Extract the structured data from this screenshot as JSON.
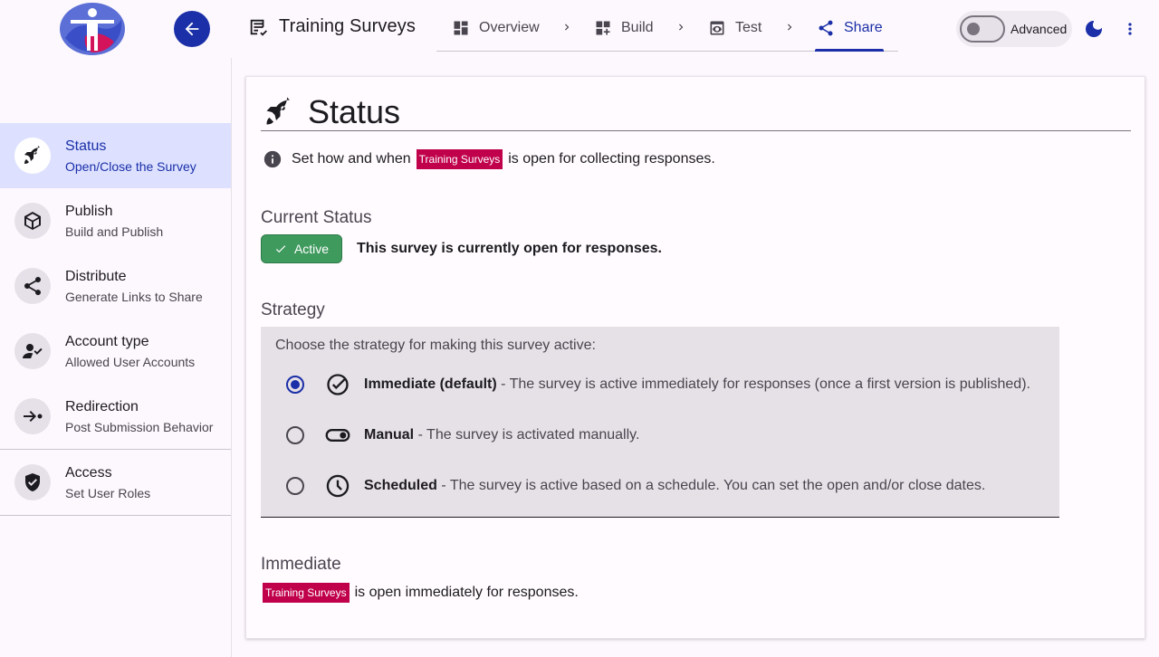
{
  "app": {
    "title": "Training Surveys"
  },
  "steps": [
    {
      "label": "Overview",
      "icon": "dashboard-icon"
    },
    {
      "label": "Build",
      "icon": "dashboard-add-icon"
    },
    {
      "label": "Test",
      "icon": "preview-icon"
    },
    {
      "label": "Share",
      "icon": "share-icon",
      "active": true
    }
  ],
  "toolbar": {
    "advanced_label": "Advanced",
    "advanced_on": false
  },
  "sidebar": {
    "items": [
      {
        "title": "Status",
        "subtitle": "Open/Close the Survey",
        "icon": "rocket-icon",
        "selected": true
      },
      {
        "title": "Publish",
        "subtitle": "Build and Publish",
        "icon": "package-icon"
      },
      {
        "title": "Distribute",
        "subtitle": "Generate Links to Share",
        "icon": "share-icon"
      },
      {
        "title": "Account type",
        "subtitle": "Allowed User Accounts",
        "icon": "person-check-icon"
      },
      {
        "title": "Redirection",
        "subtitle": "Post Submission Behavior",
        "icon": "redirect-icon"
      },
      {
        "title": "Access",
        "subtitle": "Set User Roles",
        "icon": "shield-check-icon"
      }
    ]
  },
  "main": {
    "heading": "Status",
    "info_prefix": "Set how and when",
    "survey_name": "Training Surveys",
    "info_suffix": "is open for collecting responses.",
    "current_status_title": "Current Status",
    "status_chip": "Active",
    "status_message": "This survey is currently open for responses.",
    "strategy_title": "Strategy",
    "strategy_prompt": "Choose the strategy for making this survey active:",
    "options": [
      {
        "name": "Immediate (default)",
        "desc": " - The survey is active immediately for responses (once a first version is published).",
        "icon": "check-circle-icon",
        "selected": true
      },
      {
        "name": "Manual",
        "desc": " - The survey is activated manually.",
        "icon": "toggle-icon",
        "selected": false
      },
      {
        "name": "Scheduled",
        "desc": " - The survey is active based on a schedule. You can set the open and/or close dates.",
        "icon": "clock-icon",
        "selected": false
      }
    ],
    "immediate_title": "Immediate",
    "immediate_suffix": "is open immediately for responses."
  },
  "colors": {
    "primary": "#1a2fa8",
    "chip": "#c0004b",
    "active": "#3f9a5e",
    "selected_nav": "#dde1ff"
  }
}
